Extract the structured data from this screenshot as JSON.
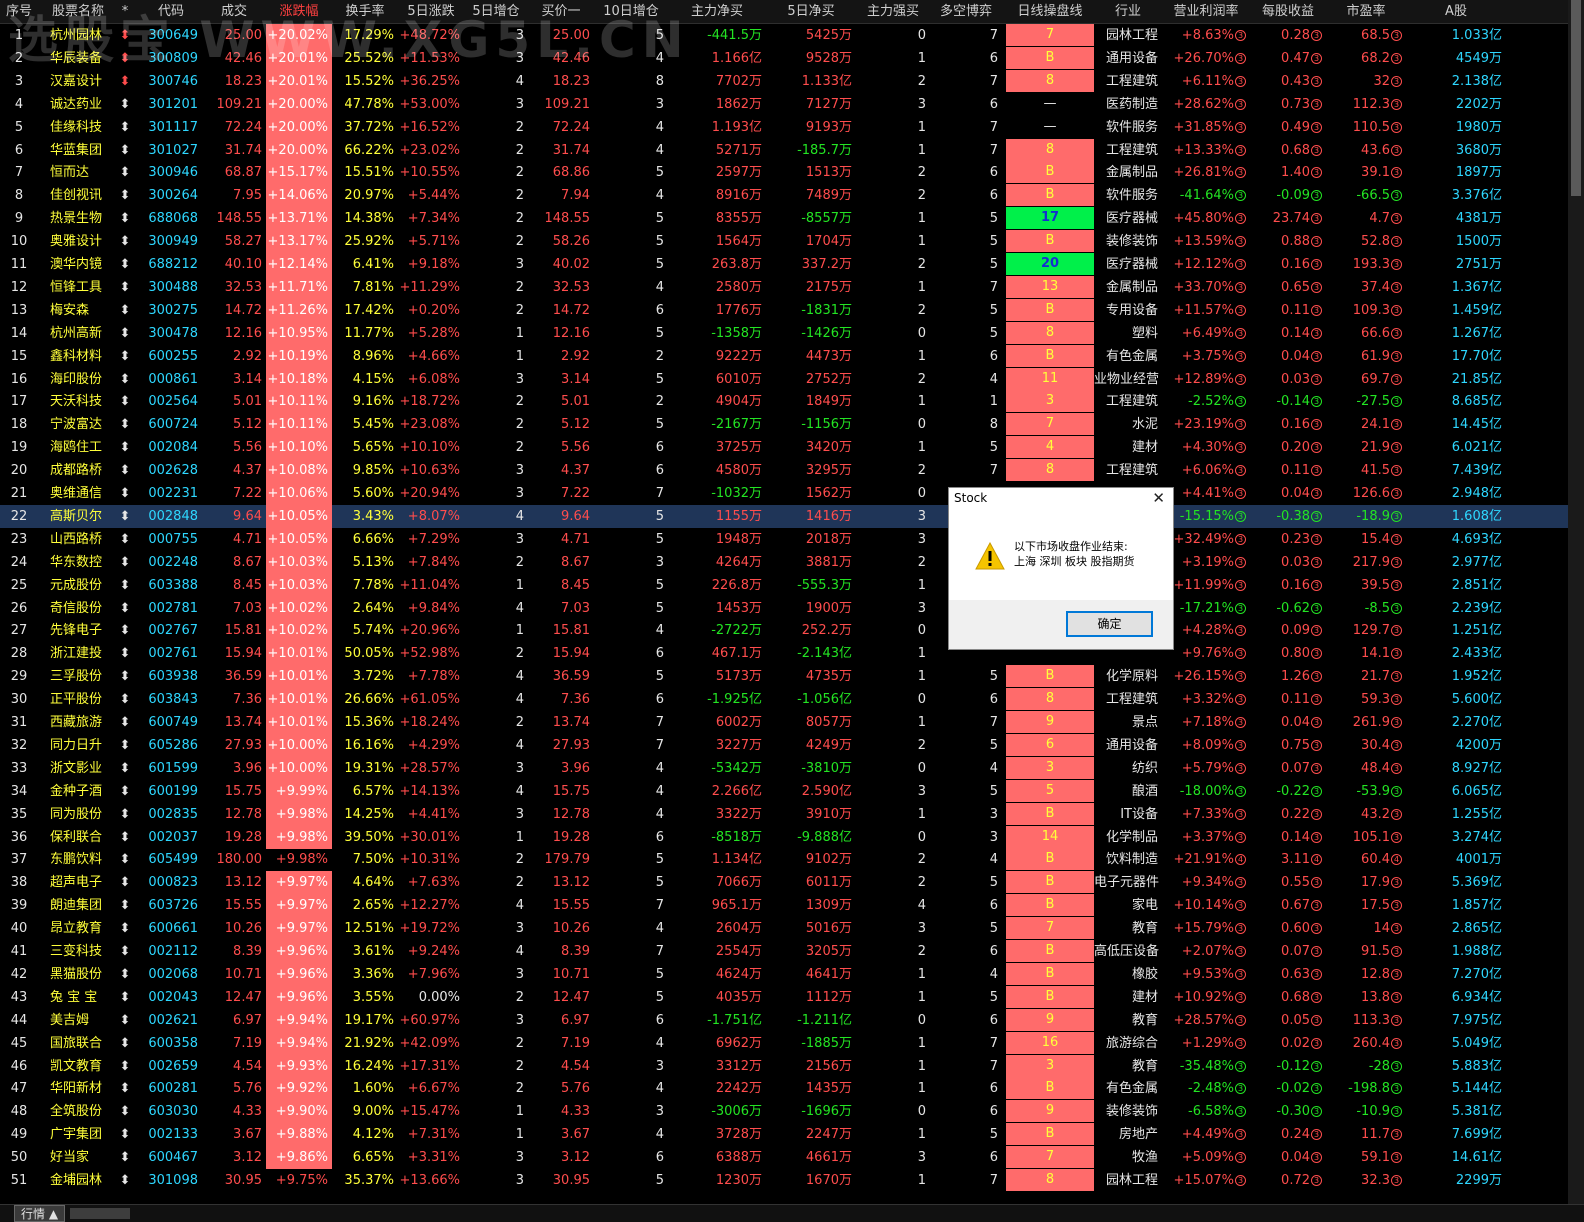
{
  "watermark": "选股宝 WWW.XG5L.CN",
  "header": [
    "序号",
    "股票名称",
    "*",
    "代码",
    "成交",
    "涨跌幅",
    "换手率",
    "5日涨跌",
    "5日增仓",
    "买价一",
    "10日增仓",
    "主力净买",
    "5日净买",
    "主力强买",
    "多空博弈",
    "日线操盘线",
    "行业",
    "营业利润率",
    "每股收益",
    "市盈率",
    "A股"
  ],
  "selected_row": 22,
  "rows": [
    [
      "1",
      "杭州园林",
      "300649",
      "25.00",
      "+20.02%",
      "17.29%",
      "+48.72%",
      "3",
      "25.00",
      "5",
      "-441.5万",
      "5425万",
      "0",
      "7",
      "7",
      "园林工程",
      "+8.63%",
      "0.28",
      "68.5",
      "1.033亿"
    ],
    [
      "2",
      "华辰装备",
      "300809",
      "42.46",
      "+20.01%",
      "25.52%",
      "+11.53%",
      "3",
      "42.46",
      "4",
      "1.166亿",
      "9528万",
      "1",
      "6",
      "B",
      "通用设备",
      "+26.70%",
      "0.47",
      "68.2",
      "4549万"
    ],
    [
      "3",
      "汉嘉设计",
      "300746",
      "18.23",
      "+20.01%",
      "15.52%",
      "+36.25%",
      "4",
      "18.23",
      "8",
      "7702万",
      "1.133亿",
      "2",
      "7",
      "8",
      "工程建筑",
      "+6.11%",
      "0.43",
      "32",
      "2.138亿"
    ],
    [
      "4",
      "诚达药业",
      "301201",
      "109.21",
      "+20.00%",
      "47.78%",
      "+53.00%",
      "3",
      "109.21",
      "3",
      "1862万",
      "7127万",
      "3",
      "6",
      "—",
      "医药制造",
      "+28.62%",
      "0.73",
      "112.3",
      "2202万"
    ],
    [
      "5",
      "佳缘科技",
      "301117",
      "72.24",
      "+20.00%",
      "37.72%",
      "+16.52%",
      "2",
      "72.24",
      "4",
      "1.193亿",
      "9193万",
      "1",
      "7",
      "—",
      "软件服务",
      "+31.85%",
      "0.49",
      "110.5",
      "1980万"
    ],
    [
      "6",
      "华蓝集团",
      "301027",
      "31.74",
      "+20.00%",
      "66.22%",
      "+23.02%",
      "2",
      "31.74",
      "4",
      "5271万",
      "-185.7万",
      "1",
      "7",
      "8",
      "工程建筑",
      "+13.33%",
      "0.68",
      "43.6",
      "3680万"
    ],
    [
      "7",
      "恒而达",
      "300946",
      "68.87",
      "+15.17%",
      "15.51%",
      "+10.55%",
      "2",
      "68.86",
      "5",
      "2597万",
      "1513万",
      "2",
      "6",
      "B",
      "金属制品",
      "+26.81%",
      "1.40",
      "39.1",
      "1897万"
    ],
    [
      "8",
      "佳创视讯",
      "300264",
      "7.95",
      "+14.06%",
      "20.97%",
      "+5.44%",
      "2",
      "7.94",
      "4",
      "8916万",
      "7489万",
      "2",
      "6",
      "B",
      "软件服务",
      "-41.64%",
      "-0.09",
      "-66.5",
      "3.376亿"
    ],
    [
      "9",
      "热景生物",
      "688068",
      "148.55",
      "+13.71%",
      "14.38%",
      "+7.34%",
      "2",
      "148.55",
      "5",
      "8355万",
      "-8557万",
      "1",
      "5",
      "17",
      "医疗器械",
      "+45.80%",
      "23.74",
      "4.7",
      "4381万"
    ],
    [
      "10",
      "奥雅设计",
      "300949",
      "58.27",
      "+13.17%",
      "25.92%",
      "+5.71%",
      "2",
      "58.26",
      "5",
      "1564万",
      "1704万",
      "1",
      "5",
      "B",
      "装修装饰",
      "+13.59%",
      "0.88",
      "52.8",
      "1500万"
    ],
    [
      "11",
      "澳华内镜",
      "688212",
      "40.10",
      "+12.14%",
      "6.41%",
      "+9.18%",
      "3",
      "40.02",
      "5",
      "263.8万",
      "337.2万",
      "2",
      "5",
      "20",
      "医疗器械",
      "+12.12%",
      "0.16",
      "193.3",
      "2751万"
    ],
    [
      "12",
      "恒锋工具",
      "300488",
      "32.53",
      "+11.71%",
      "7.81%",
      "+11.29%",
      "2",
      "32.53",
      "4",
      "2580万",
      "2175万",
      "1",
      "7",
      "13",
      "金属制品",
      "+33.70%",
      "0.65",
      "37.4",
      "1.367亿"
    ],
    [
      "13",
      "梅安森",
      "300275",
      "14.72",
      "+11.26%",
      "17.42%",
      "+0.20%",
      "2",
      "14.72",
      "6",
      "1776万",
      "-1831万",
      "2",
      "5",
      "B",
      "专用设备",
      "+11.57%",
      "0.11",
      "109.3",
      "1.459亿"
    ],
    [
      "14",
      "杭州高新",
      "300478",
      "12.16",
      "+10.95%",
      "11.77%",
      "+5.28%",
      "1",
      "12.16",
      "5",
      "-1358万",
      "-1426万",
      "0",
      "5",
      "8",
      "塑料",
      "+6.49%",
      "0.14",
      "66.6",
      "1.267亿"
    ],
    [
      "15",
      "鑫科材料",
      "600255",
      "2.92",
      "+10.19%",
      "8.96%",
      "+4.66%",
      "1",
      "2.92",
      "2",
      "9222万",
      "4473万",
      "1",
      "6",
      "B",
      "有色金属",
      "+3.75%",
      "0.04",
      "61.9",
      "17.70亿"
    ],
    [
      "16",
      "海印股份",
      "000861",
      "3.14",
      "+10.18%",
      "4.15%",
      "+6.08%",
      "3",
      "3.14",
      "5",
      "6010万",
      "2752万",
      "2",
      "4",
      "11",
      "业物业经营",
      "+12.89%",
      "0.03",
      "69.7",
      "21.85亿"
    ],
    [
      "17",
      "天沃科技",
      "002564",
      "5.01",
      "+10.11%",
      "9.16%",
      "+18.72%",
      "2",
      "5.01",
      "2",
      "4904万",
      "1849万",
      "1",
      "1",
      "3",
      "工程建筑",
      "-2.52%",
      "-0.14",
      "-27.5",
      "8.685亿"
    ],
    [
      "18",
      "宁波富达",
      "600724",
      "5.12",
      "+10.11%",
      "5.45%",
      "+23.08%",
      "2",
      "5.12",
      "5",
      "-2167万",
      "-1156万",
      "0",
      "8",
      "7",
      "水泥",
      "+23.19%",
      "0.16",
      "24.1",
      "14.45亿"
    ],
    [
      "19",
      "海鸥住工",
      "002084",
      "5.56",
      "+10.10%",
      "5.65%",
      "+10.10%",
      "2",
      "5.56",
      "6",
      "3725万",
      "3420万",
      "1",
      "5",
      "4",
      "建材",
      "+4.30%",
      "0.20",
      "21.9",
      "6.021亿"
    ],
    [
      "20",
      "成都路桥",
      "002628",
      "4.37",
      "+10.08%",
      "9.85%",
      "+10.63%",
      "3",
      "4.37",
      "6",
      "4580万",
      "3295万",
      "2",
      "7",
      "8",
      "工程建筑",
      "+6.06%",
      "0.11",
      "41.5",
      "7.439亿"
    ],
    [
      "21",
      "奥维通信",
      "002231",
      "7.22",
      "+10.06%",
      "5.60%",
      "+20.94%",
      "3",
      "7.22",
      "7",
      "-1032万",
      "1562万",
      "0",
      "",
      "",
      "",
      "+4.41%",
      "0.04",
      "126.6",
      "2.948亿"
    ],
    [
      "22",
      "高斯贝尔",
      "002848",
      "9.64",
      "+10.05%",
      "3.43%",
      "+8.07%",
      "4",
      "9.64",
      "5",
      "1155万",
      "1416万",
      "3",
      "",
      "",
      "",
      "-15.15%",
      "-0.38",
      "-18.9",
      "1.608亿"
    ],
    [
      "23",
      "山西路桥",
      "000755",
      "4.71",
      "+10.05%",
      "6.66%",
      "+7.29%",
      "3",
      "4.71",
      "5",
      "1948万",
      "2018万",
      "3",
      "",
      "",
      "",
      "+32.49%",
      "0.23",
      "15.4",
      "4.693亿"
    ],
    [
      "24",
      "华东数控",
      "002248",
      "8.67",
      "+10.03%",
      "5.13%",
      "+7.84%",
      "2",
      "8.67",
      "3",
      "4264万",
      "3881万",
      "2",
      "",
      "",
      "",
      "+3.19%",
      "0.03",
      "217.9",
      "2.977亿"
    ],
    [
      "25",
      "元成股份",
      "603388",
      "8.45",
      "+10.03%",
      "7.78%",
      "+11.04%",
      "1",
      "8.45",
      "5",
      "226.8万",
      "-555.3万",
      "1",
      "",
      "",
      "",
      "+11.99%",
      "0.16",
      "39.5",
      "2.851亿"
    ],
    [
      "26",
      "奇信股份",
      "002781",
      "7.03",
      "+10.02%",
      "2.64%",
      "+9.84%",
      "4",
      "7.03",
      "5",
      "1453万",
      "1900万",
      "3",
      "",
      "",
      "",
      "-17.21%",
      "-0.62",
      "-8.5",
      "2.239亿"
    ],
    [
      "27",
      "先锋电子",
      "002767",
      "15.81",
      "+10.02%",
      "5.74%",
      "+20.96%",
      "1",
      "15.81",
      "4",
      "-2722万",
      "252.2万",
      "0",
      "",
      "",
      "",
      "+4.28%",
      "0.09",
      "129.7",
      "1.251亿"
    ],
    [
      "28",
      "浙江建投",
      "002761",
      "15.94",
      "+10.01%",
      "50.05%",
      "+52.98%",
      "2",
      "15.94",
      "6",
      "467.1万",
      "-2.143亿",
      "1",
      "",
      "",
      "",
      "+9.76%",
      "0.80",
      "14.1",
      "2.433亿"
    ],
    [
      "29",
      "三孚股份",
      "603938",
      "36.59",
      "+10.01%",
      "3.72%",
      "+7.78%",
      "4",
      "36.59",
      "5",
      "5173万",
      "4735万",
      "1",
      "5",
      "B",
      "化学原料",
      "+26.15%",
      "1.26",
      "21.7",
      "1.952亿"
    ],
    [
      "30",
      "正平股份",
      "603843",
      "7.36",
      "+10.01%",
      "26.66%",
      "+61.05%",
      "4",
      "7.36",
      "6",
      "-1.925亿",
      "-1.056亿",
      "0",
      "6",
      "8",
      "工程建筑",
      "+3.32%",
      "0.11",
      "59.3",
      "5.600亿"
    ],
    [
      "31",
      "西藏旅游",
      "600749",
      "13.74",
      "+10.01%",
      "15.36%",
      "+18.24%",
      "2",
      "13.74",
      "7",
      "6002万",
      "8057万",
      "1",
      "7",
      "9",
      "景点",
      "+7.18%",
      "0.04",
      "261.9",
      "2.270亿"
    ],
    [
      "32",
      "同力日升",
      "605286",
      "27.93",
      "+10.00%",
      "16.16%",
      "+4.29%",
      "4",
      "27.93",
      "7",
      "3227万",
      "4249万",
      "2",
      "5",
      "6",
      "通用设备",
      "+8.09%",
      "0.75",
      "30.4",
      "4200万"
    ],
    [
      "33",
      "浙文影业",
      "601599",
      "3.96",
      "+10.00%",
      "19.31%",
      "+28.57%",
      "3",
      "3.96",
      "4",
      "-5342万",
      "-3810万",
      "0",
      "4",
      "3",
      "纺织",
      "+5.79%",
      "0.07",
      "48.4",
      "8.927亿"
    ],
    [
      "34",
      "金种子酒",
      "600199",
      "15.75",
      "+9.99%",
      "6.57%",
      "+14.13%",
      "4",
      "15.75",
      "4",
      "2.266亿",
      "2.590亿",
      "3",
      "5",
      "5",
      "酿酒",
      "-18.00%",
      "-0.22",
      "-53.9",
      "6.065亿"
    ],
    [
      "35",
      "同为股份",
      "002835",
      "12.78",
      "+9.98%",
      "14.25%",
      "+4.41%",
      "3",
      "12.78",
      "4",
      "3322万",
      "3910万",
      "1",
      "3",
      "B",
      "IT设备",
      "+7.33%",
      "0.22",
      "43.2",
      "1.255亿"
    ],
    [
      "36",
      "保利联合",
      "002037",
      "19.28",
      "+9.98%",
      "39.50%",
      "+30.01%",
      "1",
      "19.28",
      "6",
      "-8518万",
      "-9.888亿",
      "0",
      "3",
      "14",
      "化学制品",
      "+3.37%",
      "0.14",
      "105.1",
      "3.274亿"
    ],
    [
      "37",
      "东鹏饮料",
      "605499",
      "180.00",
      "+9.98%",
      "7.50%",
      "+10.31%",
      "2",
      "179.79",
      "5",
      "1.134亿",
      "9102万",
      "2",
      "4",
      "B",
      "饮料制造",
      "+21.91%",
      "3.11",
      "60.4",
      "4001万"
    ],
    [
      "38",
      "超声电子",
      "000823",
      "13.12",
      "+9.97%",
      "4.64%",
      "+7.63%",
      "2",
      "13.12",
      "5",
      "7066万",
      "6011万",
      "2",
      "5",
      "B",
      "电子元器件",
      "+9.34%",
      "0.55",
      "17.9",
      "5.369亿"
    ],
    [
      "39",
      "朗迪集团",
      "603726",
      "15.55",
      "+9.97%",
      "2.65%",
      "+12.27%",
      "4",
      "15.55",
      "7",
      "965.1万",
      "1309万",
      "4",
      "6",
      "B",
      "家电",
      "+10.14%",
      "0.67",
      "17.5",
      "1.857亿"
    ],
    [
      "40",
      "昂立教育",
      "600661",
      "10.26",
      "+9.97%",
      "12.51%",
      "+19.72%",
      "3",
      "10.26",
      "4",
      "2604万",
      "5016万",
      "3",
      "5",
      "7",
      "教育",
      "+15.79%",
      "0.60",
      "14",
      "2.865亿"
    ],
    [
      "41",
      "三变科技",
      "002112",
      "8.39",
      "+9.96%",
      "3.61%",
      "+9.24%",
      "4",
      "8.39",
      "7",
      "2554万",
      "3205万",
      "2",
      "6",
      "B",
      "高低压设备",
      "+2.07%",
      "0.07",
      "91.5",
      "1.988亿"
    ],
    [
      "42",
      "黑猫股份",
      "002068",
      "10.71",
      "+9.96%",
      "3.36%",
      "+7.96%",
      "3",
      "10.71",
      "5",
      "4624万",
      "4641万",
      "1",
      "4",
      "B",
      "橡胶",
      "+9.53%",
      "0.63",
      "12.8",
      "7.270亿"
    ],
    [
      "43",
      "兔 宝 宝",
      "002043",
      "12.47",
      "+9.96%",
      "3.55%",
      "0.00%",
      "2",
      "12.47",
      "5",
      "4035万",
      "1112万",
      "1",
      "5",
      "B",
      "建材",
      "+10.92%",
      "0.68",
      "13.8",
      "6.934亿"
    ],
    [
      "44",
      "美吉姆",
      "002621",
      "6.97",
      "+9.94%",
      "19.17%",
      "+60.97%",
      "3",
      "6.97",
      "6",
      "-1.751亿",
      "-1.211亿",
      "0",
      "6",
      "9",
      "教育",
      "+28.57%",
      "0.05",
      "113.3",
      "7.975亿"
    ],
    [
      "45",
      "国旅联合",
      "600358",
      "7.19",
      "+9.94%",
      "21.92%",
      "+42.09%",
      "2",
      "7.19",
      "4",
      "6962万",
      "-1885万",
      "1",
      "7",
      "16",
      "旅游综合",
      "+1.29%",
      "0.02",
      "260.4",
      "5.049亿"
    ],
    [
      "46",
      "凯文教育",
      "002659",
      "4.54",
      "+9.93%",
      "16.24%",
      "+17.31%",
      "2",
      "4.54",
      "3",
      "3312万",
      "2156万",
      "1",
      "7",
      "3",
      "教育",
      "-35.48%",
      "-0.12",
      "-28",
      "5.883亿"
    ],
    [
      "47",
      "华阳新材",
      "600281",
      "5.76",
      "+9.92%",
      "1.60%",
      "+6.67%",
      "2",
      "5.76",
      "4",
      "2242万",
      "1435万",
      "1",
      "6",
      "B",
      "有色金属",
      "-2.48%",
      "-0.02",
      "-198.8",
      "5.144亿"
    ],
    [
      "48",
      "全筑股份",
      "603030",
      "4.33",
      "+9.90%",
      "9.00%",
      "+15.47%",
      "1",
      "4.33",
      "3",
      "-3006万",
      "-1696万",
      "0",
      "6",
      "9",
      "装修装饰",
      "-6.58%",
      "-0.30",
      "-10.9",
      "5.381亿"
    ],
    [
      "49",
      "广宇集团",
      "002133",
      "3.67",
      "+9.88%",
      "4.12%",
      "+7.31%",
      "1",
      "3.67",
      "4",
      "3728万",
      "2247万",
      "1",
      "5",
      "B",
      "房地产",
      "+4.49%",
      "0.24",
      "11.7",
      "7.699亿"
    ],
    [
      "50",
      "好当家",
      "600467",
      "3.12",
      "+9.86%",
      "6.65%",
      "+3.31%",
      "3",
      "3.12",
      "6",
      "6388万",
      "4661万",
      "3",
      "6",
      "7",
      "牧渔",
      "+5.09%",
      "0.04",
      "59.1",
      "14.61亿"
    ],
    [
      "51",
      "金埔园林",
      "301098",
      "30.95",
      "+9.75%",
      "35.37%",
      "+13.66%",
      "3",
      "30.95",
      "5",
      "1230万",
      "1670万",
      "1",
      "7",
      "8",
      "园林工程",
      "+15.07%",
      "0.72",
      "32.3",
      "2299万"
    ]
  ],
  "bottom_tab": "行情 ▲",
  "dialog": {
    "title": "Stock",
    "close": "✕",
    "line1": "以下市场收盘作业结束:",
    "line2": "上海 深圳 板块 股指期货",
    "ok": "确定"
  },
  "colors": {
    "up": "#ff4d4d",
    "down": "#23e423",
    "name": "#ffff3a",
    "code": "#2ed7ff",
    "highlight_bg": "#ff6b6b",
    "selected_row_bg": "#1f3558"
  }
}
